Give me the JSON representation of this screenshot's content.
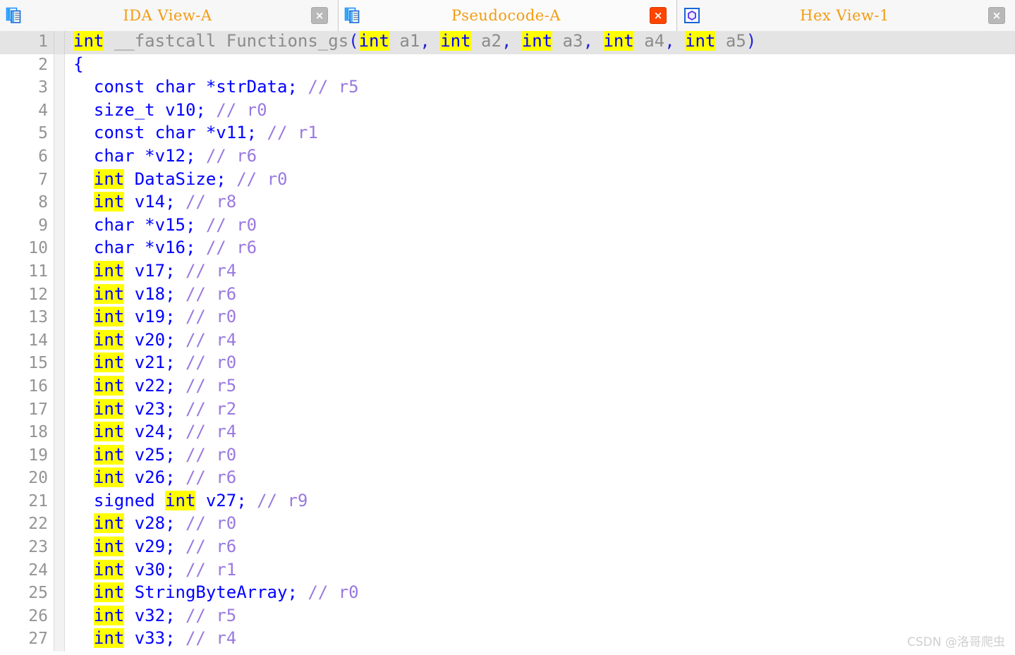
{
  "tabs": [
    {
      "label": "IDA View-A",
      "icon": "document-pages-icon",
      "active": false,
      "close_label": "×",
      "close_accent": false
    },
    {
      "label": "Pseudocode-A",
      "icon": "document-pages-icon",
      "active": true,
      "close_label": "×",
      "close_accent": true
    },
    {
      "label": "Hex View-1",
      "icon": "hexagon-icon",
      "active": false,
      "close_label": "×",
      "close_accent": false
    }
  ],
  "editor": {
    "current_line": 1,
    "highlight_term": "int",
    "lines": [
      {
        "n": "1",
        "tokens": [
          {
            "t": "int",
            "c": "hl"
          },
          {
            "t": " __fastcall ",
            "c": "dim"
          },
          {
            "t": "Functions_gs",
            "c": "dim"
          },
          {
            "t": "(",
            "c": "paren"
          },
          {
            "t": "int",
            "c": "hl"
          },
          {
            "t": " a1",
            "c": "dim"
          },
          {
            "t": ",",
            "c": "paren"
          },
          {
            "t": " ",
            "c": "dim"
          },
          {
            "t": "int",
            "c": "hl"
          },
          {
            "t": " a2",
            "c": "dim"
          },
          {
            "t": ",",
            "c": "paren"
          },
          {
            "t": " ",
            "c": "dim"
          },
          {
            "t": "int",
            "c": "hl"
          },
          {
            "t": " a3",
            "c": "dim"
          },
          {
            "t": ",",
            "c": "paren"
          },
          {
            "t": " ",
            "c": "dim"
          },
          {
            "t": "int",
            "c": "hl"
          },
          {
            "t": " a4",
            "c": "dim"
          },
          {
            "t": ",",
            "c": "paren"
          },
          {
            "t": " ",
            "c": "dim"
          },
          {
            "t": "int",
            "c": "hl"
          },
          {
            "t": " a5",
            "c": "dim"
          },
          {
            "t": ")",
            "c": "paren"
          }
        ]
      },
      {
        "n": "2",
        "tokens": [
          {
            "t": "{",
            "c": "kw"
          }
        ]
      },
      {
        "n": "3",
        "tokens": [
          {
            "t": "  const char *strData;",
            "c": "kw"
          },
          {
            "t": " // ",
            "c": "cmt"
          },
          {
            "t": "r5",
            "c": "cmt"
          }
        ]
      },
      {
        "n": "4",
        "tokens": [
          {
            "t": "  size_t v10;",
            "c": "kw"
          },
          {
            "t": " // ",
            "c": "cmt"
          },
          {
            "t": "r0",
            "c": "cmt"
          }
        ]
      },
      {
        "n": "5",
        "tokens": [
          {
            "t": "  const char *v11;",
            "c": "kw"
          },
          {
            "t": " // ",
            "c": "cmt"
          },
          {
            "t": "r1",
            "c": "cmt"
          }
        ]
      },
      {
        "n": "6",
        "tokens": [
          {
            "t": "  char *v12;",
            "c": "kw"
          },
          {
            "t": " // ",
            "c": "cmt"
          },
          {
            "t": "r6",
            "c": "cmt"
          }
        ]
      },
      {
        "n": "7",
        "tokens": [
          {
            "t": "  ",
            "c": "kw"
          },
          {
            "t": "int",
            "c": "hl"
          },
          {
            "t": " DataSize;",
            "c": "kw"
          },
          {
            "t": " // ",
            "c": "cmt"
          },
          {
            "t": "r0",
            "c": "cmt"
          }
        ]
      },
      {
        "n": "8",
        "tokens": [
          {
            "t": "  ",
            "c": "kw"
          },
          {
            "t": "int",
            "c": "hl"
          },
          {
            "t": " v14;",
            "c": "kw"
          },
          {
            "t": " // ",
            "c": "cmt"
          },
          {
            "t": "r8",
            "c": "cmt"
          }
        ]
      },
      {
        "n": "9",
        "tokens": [
          {
            "t": "  char *v15;",
            "c": "kw"
          },
          {
            "t": " // ",
            "c": "cmt"
          },
          {
            "t": "r0",
            "c": "cmt"
          }
        ]
      },
      {
        "n": "10",
        "tokens": [
          {
            "t": "  char *v16;",
            "c": "kw"
          },
          {
            "t": " // ",
            "c": "cmt"
          },
          {
            "t": "r6",
            "c": "cmt"
          }
        ]
      },
      {
        "n": "11",
        "tokens": [
          {
            "t": "  ",
            "c": "kw"
          },
          {
            "t": "int",
            "c": "hl"
          },
          {
            "t": " v17;",
            "c": "kw"
          },
          {
            "t": " // ",
            "c": "cmt"
          },
          {
            "t": "r4",
            "c": "cmt"
          }
        ]
      },
      {
        "n": "12",
        "tokens": [
          {
            "t": "  ",
            "c": "kw"
          },
          {
            "t": "int",
            "c": "hl"
          },
          {
            "t": " v18;",
            "c": "kw"
          },
          {
            "t": " // ",
            "c": "cmt"
          },
          {
            "t": "r6",
            "c": "cmt"
          }
        ]
      },
      {
        "n": "13",
        "tokens": [
          {
            "t": "  ",
            "c": "kw"
          },
          {
            "t": "int",
            "c": "hl"
          },
          {
            "t": " v19;",
            "c": "kw"
          },
          {
            "t": " // ",
            "c": "cmt"
          },
          {
            "t": "r0",
            "c": "cmt"
          }
        ]
      },
      {
        "n": "14",
        "tokens": [
          {
            "t": "  ",
            "c": "kw"
          },
          {
            "t": "int",
            "c": "hl"
          },
          {
            "t": " v20;",
            "c": "kw"
          },
          {
            "t": " // ",
            "c": "cmt"
          },
          {
            "t": "r4",
            "c": "cmt"
          }
        ]
      },
      {
        "n": "15",
        "tokens": [
          {
            "t": "  ",
            "c": "kw"
          },
          {
            "t": "int",
            "c": "hl"
          },
          {
            "t": " v21;",
            "c": "kw"
          },
          {
            "t": " // ",
            "c": "cmt"
          },
          {
            "t": "r0",
            "c": "cmt"
          }
        ]
      },
      {
        "n": "16",
        "tokens": [
          {
            "t": "  ",
            "c": "kw"
          },
          {
            "t": "int",
            "c": "hl"
          },
          {
            "t": " v22;",
            "c": "kw"
          },
          {
            "t": " // ",
            "c": "cmt"
          },
          {
            "t": "r5",
            "c": "cmt"
          }
        ]
      },
      {
        "n": "17",
        "tokens": [
          {
            "t": "  ",
            "c": "kw"
          },
          {
            "t": "int",
            "c": "hl"
          },
          {
            "t": " v23;",
            "c": "kw"
          },
          {
            "t": " // ",
            "c": "cmt"
          },
          {
            "t": "r2",
            "c": "cmt"
          }
        ]
      },
      {
        "n": "18",
        "tokens": [
          {
            "t": "  ",
            "c": "kw"
          },
          {
            "t": "int",
            "c": "hl"
          },
          {
            "t": " v24;",
            "c": "kw"
          },
          {
            "t": " // ",
            "c": "cmt"
          },
          {
            "t": "r4",
            "c": "cmt"
          }
        ]
      },
      {
        "n": "19",
        "tokens": [
          {
            "t": "  ",
            "c": "kw"
          },
          {
            "t": "int",
            "c": "hl"
          },
          {
            "t": " v25;",
            "c": "kw"
          },
          {
            "t": " // ",
            "c": "cmt"
          },
          {
            "t": "r0",
            "c": "cmt"
          }
        ]
      },
      {
        "n": "20",
        "tokens": [
          {
            "t": "  ",
            "c": "kw"
          },
          {
            "t": "int",
            "c": "hl"
          },
          {
            "t": " v26;",
            "c": "kw"
          },
          {
            "t": " // ",
            "c": "cmt"
          },
          {
            "t": "r6",
            "c": "cmt"
          }
        ]
      },
      {
        "n": "21",
        "tokens": [
          {
            "t": "  signed ",
            "c": "kw"
          },
          {
            "t": "int",
            "c": "hl"
          },
          {
            "t": " v27;",
            "c": "kw"
          },
          {
            "t": " // ",
            "c": "cmt"
          },
          {
            "t": "r9",
            "c": "cmt"
          }
        ]
      },
      {
        "n": "22",
        "tokens": [
          {
            "t": "  ",
            "c": "kw"
          },
          {
            "t": "int",
            "c": "hl"
          },
          {
            "t": " v28;",
            "c": "kw"
          },
          {
            "t": " // ",
            "c": "cmt"
          },
          {
            "t": "r0",
            "c": "cmt"
          }
        ]
      },
      {
        "n": "23",
        "tokens": [
          {
            "t": "  ",
            "c": "kw"
          },
          {
            "t": "int",
            "c": "hl"
          },
          {
            "t": " v29;",
            "c": "kw"
          },
          {
            "t": " // ",
            "c": "cmt"
          },
          {
            "t": "r6",
            "c": "cmt"
          }
        ]
      },
      {
        "n": "24",
        "tokens": [
          {
            "t": "  ",
            "c": "kw"
          },
          {
            "t": "int",
            "c": "hl"
          },
          {
            "t": " v30;",
            "c": "kw"
          },
          {
            "t": " // ",
            "c": "cmt"
          },
          {
            "t": "r1",
            "c": "cmt"
          }
        ]
      },
      {
        "n": "25",
        "tokens": [
          {
            "t": "  ",
            "c": "kw"
          },
          {
            "t": "int",
            "c": "hl"
          },
          {
            "t": " StringByteArray;",
            "c": "kw"
          },
          {
            "t": " // ",
            "c": "cmt"
          },
          {
            "t": "r0",
            "c": "cmt"
          }
        ]
      },
      {
        "n": "26",
        "tokens": [
          {
            "t": "  ",
            "c": "kw"
          },
          {
            "t": "int",
            "c": "hl"
          },
          {
            "t": " v32;",
            "c": "kw"
          },
          {
            "t": " // ",
            "c": "cmt"
          },
          {
            "t": "r5",
            "c": "cmt"
          }
        ]
      },
      {
        "n": "27",
        "tokens": [
          {
            "t": "  ",
            "c": "kw"
          },
          {
            "t": "int",
            "c": "hl"
          },
          {
            "t": " v33;",
            "c": "kw"
          },
          {
            "t": " // ",
            "c": "cmt"
          },
          {
            "t": "r4",
            "c": "cmt"
          }
        ]
      }
    ]
  },
  "watermark": {
    "text": "CSDN @洛哥爬虫"
  },
  "colors": {
    "keyword": "#0000ff",
    "comment": "#9a79e0",
    "highlight_bg": "#ffff00",
    "current_line_bg": "#e4e4e4",
    "tab_title": "#f39c12",
    "close_accent": "#ff4500"
  }
}
